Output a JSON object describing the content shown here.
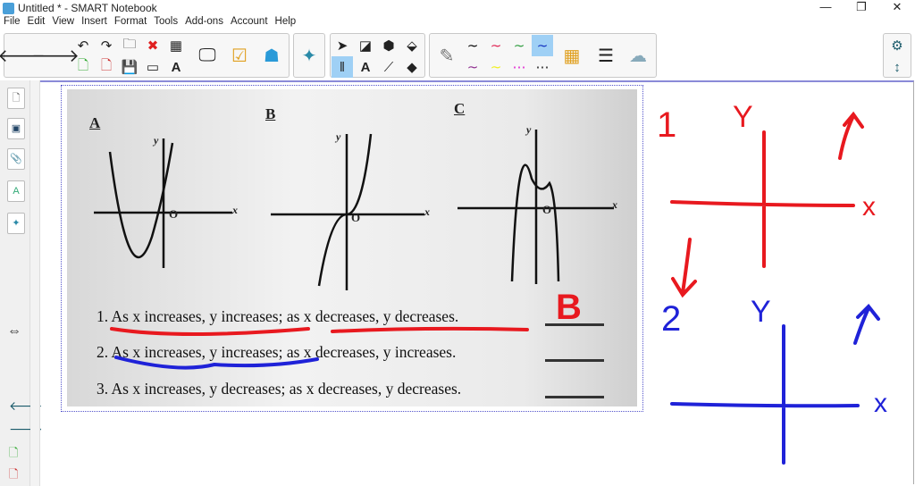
{
  "window": {
    "title": "Untitled * - SMART Notebook",
    "minimize": "—",
    "maximize": "❐",
    "close": "✕"
  },
  "menu": [
    "File",
    "Edit",
    "View",
    "Insert",
    "Format",
    "Tools",
    "Add-ons",
    "Account",
    "Help"
  ],
  "worksheet": {
    "graph_labels": [
      "A",
      "B",
      "C"
    ],
    "axis_x": "x",
    "axis_y": "y",
    "origin": "O",
    "statements": [
      "1. As x increases, y increases; as x decreases, y decreases.",
      "2. As x increases, y increases; as x decreases, y increases.",
      "3. As x increases, y decreases; as x decreases, y decreases."
    ],
    "answer_1": "B"
  },
  "annotations": {
    "n1": "1",
    "n2": "2",
    "y1": "Y",
    "x1": "x",
    "y2": "Y",
    "x2": "x"
  },
  "colors": {
    "red": "#e8191f",
    "blue": "#1f22d8",
    "accent": "#9fd0f5"
  }
}
